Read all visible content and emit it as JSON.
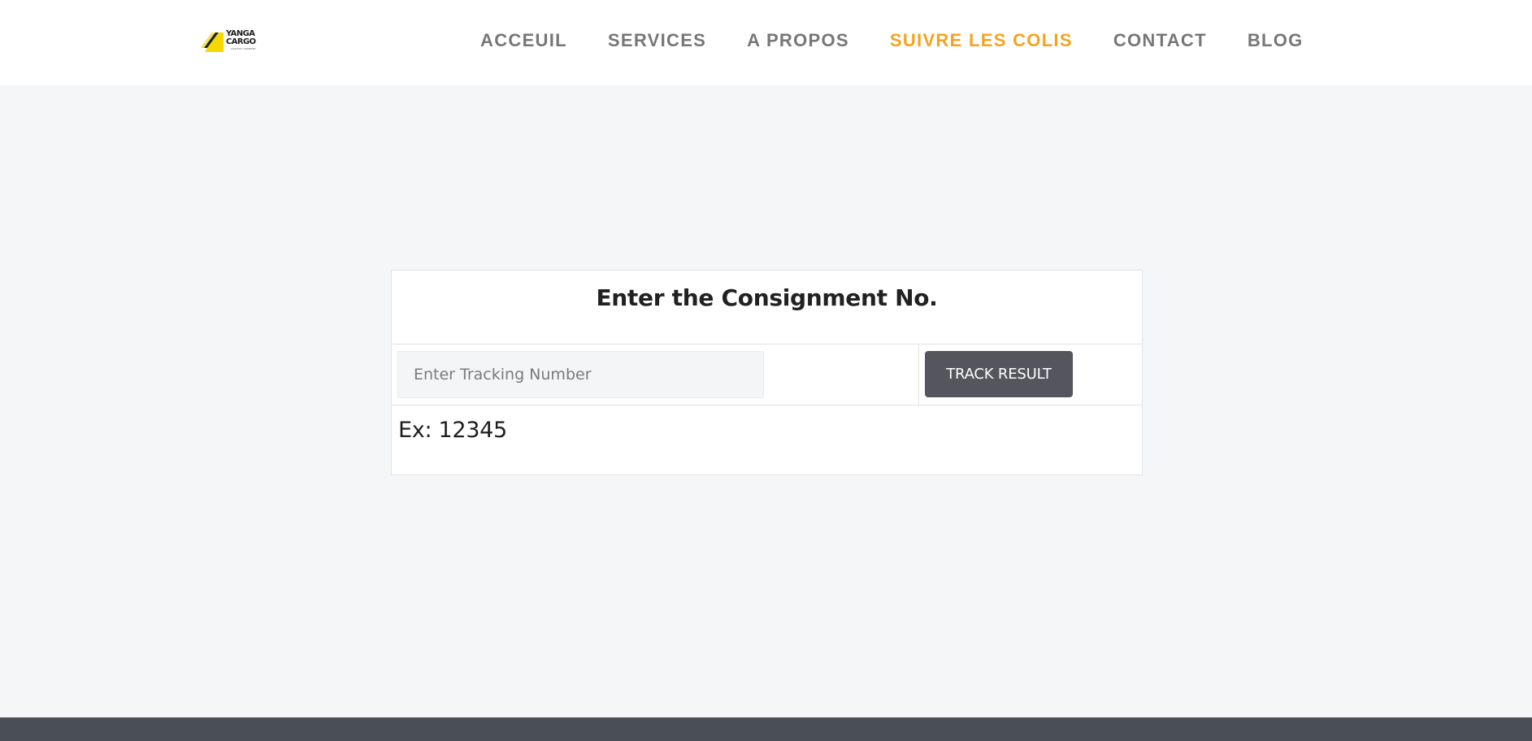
{
  "header": {
    "logo": {
      "name": "YANGA CARGO",
      "tagline": "LOGISTIC COMPANY",
      "colors": {
        "primary": "#f5d800",
        "secondary": "#1d1d1d"
      }
    },
    "nav": [
      {
        "label": "ACCEUIL",
        "active": false
      },
      {
        "label": "SERVICES",
        "active": false
      },
      {
        "label": "A PROPOS",
        "active": false
      },
      {
        "label": "SUIVRE LES COLIS",
        "active": true
      },
      {
        "label": "CONTACT",
        "active": false
      },
      {
        "label": "BLOG",
        "active": false
      }
    ],
    "colors": {
      "nav_text": "#777777",
      "nav_active": "#f5a31d"
    }
  },
  "tracking": {
    "title": "Enter the Consignment No.",
    "input_placeholder": "Enter Tracking Number",
    "input_value": "",
    "button_label": "TRACK RESULT",
    "example": "Ex: 12345",
    "colors": {
      "button_bg": "#55555e",
      "button_text": "#ffffff"
    }
  },
  "footer": {
    "colors": {
      "background": "#4a4f56"
    }
  }
}
